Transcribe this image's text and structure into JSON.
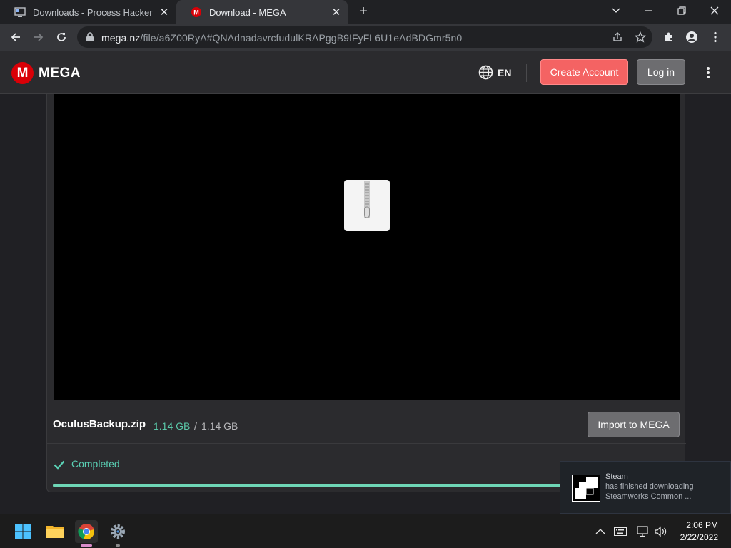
{
  "browser": {
    "tabs": [
      {
        "title": "Downloads - Process Hacker",
        "favicon": "process-hacker-icon",
        "active": false
      },
      {
        "title": "Download - MEGA",
        "favicon": "mega-icon",
        "active": true
      }
    ],
    "address": {
      "host": "mega.nz",
      "path": "/file/a6Z00RyA#QNAdnadavrcfudulKRAPggB9IFyFL6U1eAdBDGmr5n0"
    }
  },
  "header": {
    "logo_mark": "M",
    "logo_text": "MEGA",
    "language": "EN",
    "create_account": "Create Account",
    "login": "Log in"
  },
  "file": {
    "name": "OculusBackup.zip",
    "downloaded": "1.14 GB",
    "separator": "/",
    "total": "1.14 GB",
    "import_label": "Import to MEGA",
    "status": "Completed",
    "progress_fraction": 1.0
  },
  "notification": {
    "app": "Steam",
    "line1": "has finished downloading",
    "line2": "Steamworks Common ..."
  },
  "taskbar": {
    "apps": [
      "start-icon",
      "file-explorer-icon",
      "chrome-icon",
      "settings-icon"
    ],
    "time": "2:06 PM",
    "date": "2/22/2022"
  },
  "colors": {
    "accent_red": "#f46363",
    "brand_red": "#d90007",
    "success_green": "#5ad0b4"
  }
}
